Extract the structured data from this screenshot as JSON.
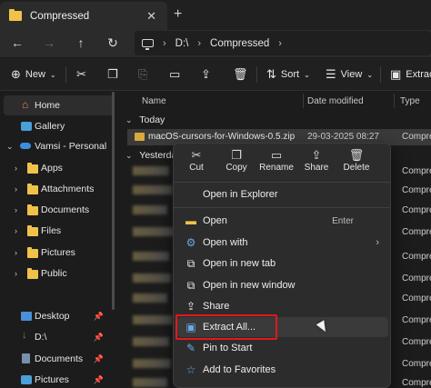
{
  "window": {
    "tab_title": "Compressed",
    "tab_close": "✕",
    "new_tab": "+"
  },
  "nav": {
    "back": "←",
    "forward": "→",
    "up": "↑",
    "refresh": "↻",
    "breadcrumbs": [
      "D:\\",
      "Compressed"
    ],
    "crumb_sep": "›"
  },
  "command_bar": {
    "new_label": "New",
    "sort_label": "Sort",
    "view_label": "View",
    "extract_label": "Extract"
  },
  "sidebar": {
    "items": [
      {
        "label": "Home"
      },
      {
        "label": "Gallery"
      },
      {
        "label": "Vamsi - Personal"
      },
      {
        "label": "Apps"
      },
      {
        "label": "Attachments"
      },
      {
        "label": "Documents"
      },
      {
        "label": "Files"
      },
      {
        "label": "Pictures"
      },
      {
        "label": "Public"
      },
      {
        "label": "Desktop"
      },
      {
        "label": "D:\\"
      },
      {
        "label": "Documents"
      },
      {
        "label": "Pictures"
      }
    ]
  },
  "file_list": {
    "columns": [
      "Name",
      "Date modified",
      "Type"
    ],
    "groups": [
      "Today",
      "Yesterday"
    ],
    "selected_file": {
      "name": "macOS-cursors-for-Windows-0.5.zip",
      "date": "29-03-2025 08:27",
      "type": "Compre"
    },
    "type_values": [
      "Compre",
      "Compre",
      "Compre",
      "Compre",
      "Compre",
      "Compre",
      "Compre",
      "Compre",
      "Compre",
      "Compre",
      "Compre"
    ]
  },
  "context_menu": {
    "quick_actions": [
      {
        "label": "Cut",
        "icon": "scissors-icon"
      },
      {
        "label": "Copy",
        "icon": "copy-icon"
      },
      {
        "label": "Rename",
        "icon": "rename-icon"
      },
      {
        "label": "Share",
        "icon": "share-icon"
      },
      {
        "label": "Delete",
        "icon": "trash-icon"
      }
    ],
    "items": [
      {
        "label": "Open in Explorer"
      },
      {
        "label": "Open",
        "shortcut": "Enter"
      },
      {
        "label": "Open with",
        "arrow": "›"
      },
      {
        "label": "Open in new tab"
      },
      {
        "label": "Open in new window"
      },
      {
        "label": "Share"
      },
      {
        "label": "Extract All..."
      },
      {
        "label": "Pin to Start"
      },
      {
        "label": "Add to Favorites"
      }
    ]
  },
  "colors": {
    "highlight_box": "#e0191e",
    "folder": "#f0c24a",
    "accent": "#4a8fd8"
  }
}
